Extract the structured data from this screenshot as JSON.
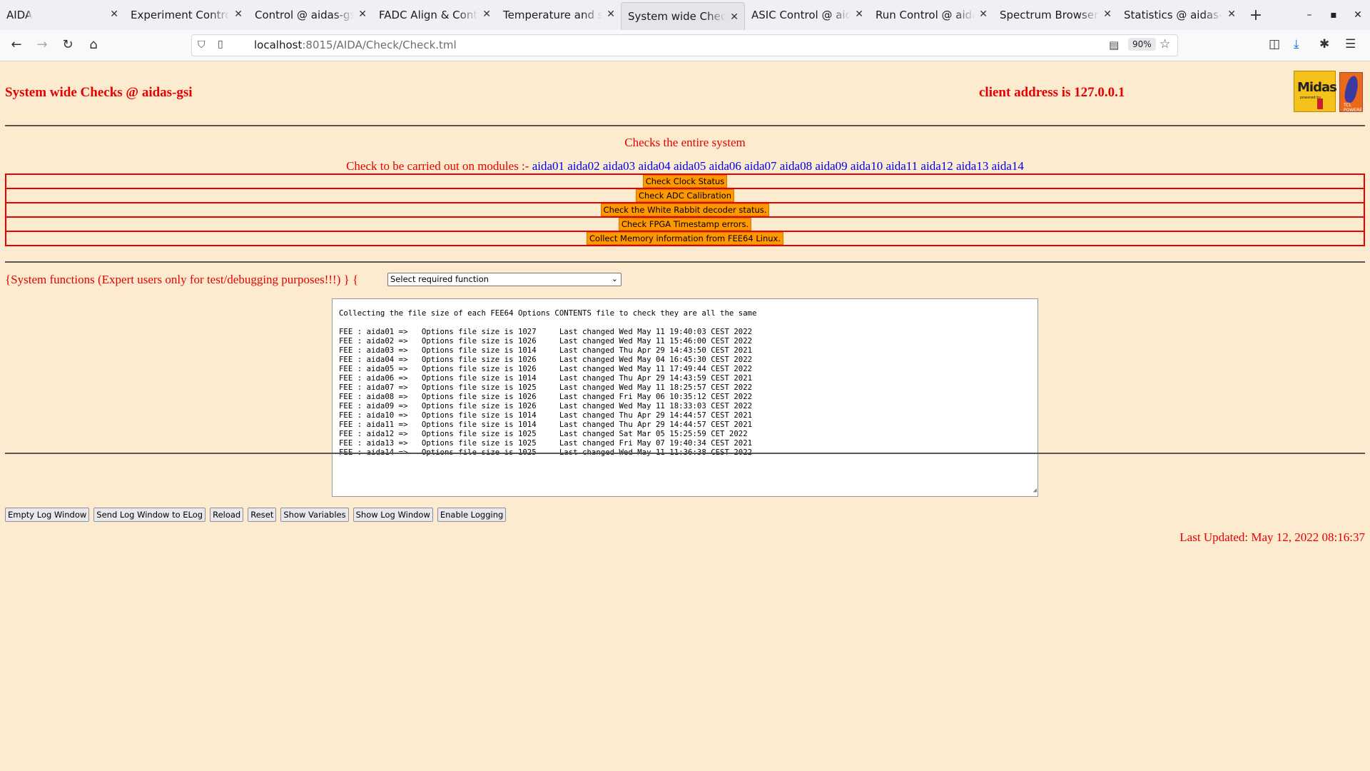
{
  "browser": {
    "tabs": [
      {
        "label": "AIDA",
        "active": false
      },
      {
        "label": "Experiment Control @ aidas-gsi",
        "active": false
      },
      {
        "label": "Control @ aidas-gsi",
        "active": false
      },
      {
        "label": "FADC Align & Control",
        "active": false
      },
      {
        "label": "Temperature and status",
        "active": false
      },
      {
        "label": "System wide Checks @ aidas-gsi",
        "active": true
      },
      {
        "label": "ASIC Control @ aidas-gsi",
        "active": false
      },
      {
        "label": "Run Control @ aidas-gsi",
        "active": false
      },
      {
        "label": "Spectrum Browser @ aidas-gsi",
        "active": false
      },
      {
        "label": "Statistics @ aidas-gsi",
        "active": false
      }
    ],
    "url_host": "localhost",
    "url_rest": ":8015/AIDA/Check/Check.tml",
    "zoom": "90%"
  },
  "header": {
    "title": "System wide Checks @ aidas-gsi",
    "client_address": "client address is 127.0.0.1",
    "midas_logo_text": "Midas",
    "tcl_logo_text": "TCL POWERED"
  },
  "checks": {
    "description": "Checks the entire system",
    "modules_prefix": "Check to be carried out on modules :- ",
    "modules": [
      "aida01",
      "aida02",
      "aida03",
      "aida04",
      "aida05",
      "aida06",
      "aida07",
      "aida08",
      "aida09",
      "aida10",
      "aida11",
      "aida12",
      "aida13",
      "aida14"
    ],
    "buttons": [
      "Check Clock Status",
      "Check ADC Calibration",
      "Check the White Rabbit decoder status.",
      "Check FPGA Timestamp errors.",
      "Collect Memory information from FEE64 Linux."
    ]
  },
  "system_functions": {
    "label": "{System functions (Expert users only for test/debugging purposes!!!)  } {",
    "select_value": "Select required function"
  },
  "log": {
    "header": "Collecting the file size of each FEE64 Options CONTENTS file to check they are all the same",
    "lines": [
      "FEE : aida01 =>   Options file size is 1027     Last changed Wed May 11 19:40:03 CEST 2022",
      "FEE : aida02 =>   Options file size is 1026     Last changed Wed May 11 15:46:00 CEST 2022",
      "FEE : aida03 =>   Options file size is 1014     Last changed Thu Apr 29 14:43:50 CEST 2021",
      "FEE : aida04 =>   Options file size is 1026     Last changed Wed May 04 16:45:30 CEST 2022",
      "FEE : aida05 =>   Options file size is 1026     Last changed Wed May 11 17:49:44 CEST 2022",
      "FEE : aida06 =>   Options file size is 1014     Last changed Thu Apr 29 14:43:59 CEST 2021",
      "FEE : aida07 =>   Options file size is 1025     Last changed Wed May 11 18:25:57 CEST 2022",
      "FEE : aida08 =>   Options file size is 1026     Last changed Fri May 06 10:35:12 CEST 2022",
      "FEE : aida09 =>   Options file size is 1026     Last changed Wed May 11 18:33:03 CEST 2022",
      "FEE : aida10 =>   Options file size is 1014     Last changed Thu Apr 29 14:44:57 CEST 2021",
      "FEE : aida11 =>   Options file size is 1014     Last changed Thu Apr 29 14:44:57 CEST 2021",
      "FEE : aida12 =>   Options file size is 1025     Last changed Sat Mar 05 15:25:59 CET 2022",
      "FEE : aida13 =>   Options file size is 1025     Last changed Fri May 07 19:40:34 CEST 2021",
      "FEE : aida14 =>   Options file size is 1025     Last changed Wed May 11 11:36:38 CEST 2022"
    ]
  },
  "actions": [
    "Empty Log Window",
    "Send Log Window to ELog",
    "Reload",
    "Reset",
    "Show Variables",
    "Show Log Window",
    "Enable Logging"
  ],
  "footer": {
    "last_updated": "Last Updated: May 12, 2022 08:16:37"
  },
  "colors": {
    "page_bg": "#fdebd0",
    "text_red": "#e60000",
    "link_blue": "#0000ee",
    "button_orange": "#ff9800"
  }
}
